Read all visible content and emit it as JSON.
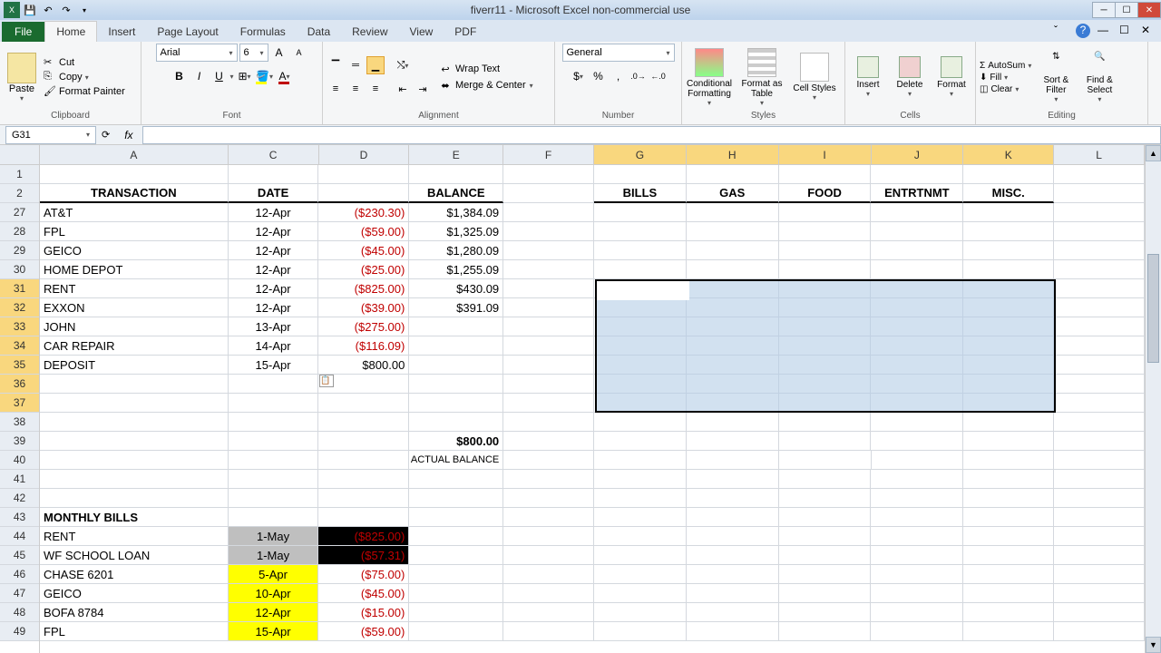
{
  "window": {
    "title": "fiverr11 - Microsoft Excel non-commercial use"
  },
  "tabs": {
    "file": "File",
    "items": [
      "Home",
      "Insert",
      "Page Layout",
      "Formulas",
      "Data",
      "Review",
      "View",
      "PDF"
    ],
    "active": "Home"
  },
  "ribbon": {
    "clipboard": {
      "label": "Clipboard",
      "paste": "Paste",
      "cut": "Cut",
      "copy": "Copy",
      "format_painter": "Format Painter"
    },
    "font": {
      "label": "Font",
      "name": "Arial",
      "size": "6"
    },
    "alignment": {
      "label": "Alignment",
      "wrap": "Wrap Text",
      "merge": "Merge & Center"
    },
    "number": {
      "label": "Number",
      "format": "General"
    },
    "styles": {
      "label": "Styles",
      "conditional": "Conditional Formatting",
      "table": "Format as Table",
      "cell": "Cell Styles"
    },
    "cells": {
      "label": "Cells",
      "insert": "Insert",
      "delete": "Delete",
      "format": "Format"
    },
    "editing": {
      "label": "Editing",
      "autosum": "AutoSum",
      "fill": "Fill",
      "clear": "Clear",
      "sort": "Sort & Filter",
      "find": "Find & Select"
    }
  },
  "namebox": "G31",
  "columns": [
    "A",
    "C",
    "D",
    "E",
    "F",
    "G",
    "H",
    "I",
    "J",
    "K",
    "L"
  ],
  "headers": {
    "A": "TRANSACTION",
    "C": "DATE",
    "E": "BALANCE",
    "G": "BILLS",
    "H": "GAS",
    "I": "FOOD",
    "J": "ENTRTNMT",
    "K": "MISC."
  },
  "row_numbers": [
    "1",
    "2",
    "27",
    "28",
    "29",
    "30",
    "31",
    "32",
    "33",
    "34",
    "35",
    "36",
    "37",
    "38",
    "39",
    "40",
    "41",
    "42",
    "43",
    "44",
    "45",
    "46",
    "47",
    "48",
    "49"
  ],
  "transactions": [
    {
      "name": "AT&T",
      "date": "12-Apr",
      "amt": "($230.30)",
      "bal": "$1,384.09"
    },
    {
      "name": "FPL",
      "date": "12-Apr",
      "amt": "($59.00)",
      "bal": "$1,325.09"
    },
    {
      "name": "GEICO",
      "date": "12-Apr",
      "amt": "($45.00)",
      "bal": "$1,280.09"
    },
    {
      "name": "HOME DEPOT",
      "date": "12-Apr",
      "amt": "($25.00)",
      "bal": "$1,255.09"
    },
    {
      "name": "RENT",
      "date": "12-Apr",
      "amt": "($825.00)",
      "bal": "$430.09"
    },
    {
      "name": "EXXON",
      "date": "12-Apr",
      "amt": "($39.00)",
      "bal": "$391.09"
    },
    {
      "name": "JOHN",
      "date": "13-Apr",
      "amt": "($275.00)",
      "bal": ""
    },
    {
      "name": "CAR REPAIR",
      "date": "14-Apr",
      "amt": "($116.09)",
      "bal": ""
    },
    {
      "name": "DEPOSIT",
      "date": "15-Apr",
      "amt": "$800.00",
      "bal": "",
      "black": true
    }
  ],
  "actual_balance": {
    "value": "$800.00",
    "label": "ACTUAL BALANCE"
  },
  "monthly_bills_header": "MONTHLY BILLS",
  "monthly_bills": [
    {
      "name": "RENT",
      "date": "1-May",
      "amt": "($825.00)",
      "style": "dark"
    },
    {
      "name": "WF SCHOOL LOAN",
      "date": "1-May",
      "amt": "($57.31)",
      "style": "dark"
    },
    {
      "name": "CHASE 6201",
      "date": "5-Apr",
      "amt": "($75.00)",
      "style": "yellow"
    },
    {
      "name": "GEICO",
      "date": "10-Apr",
      "amt": "($45.00)",
      "style": "yellow"
    },
    {
      "name": "BOFA 8784",
      "date": "12-Apr",
      "amt": "($15.00)",
      "style": "yellow"
    },
    {
      "name": "FPL",
      "date": "15-Apr",
      "amt": "($59.00)",
      "style": "yellow"
    }
  ]
}
